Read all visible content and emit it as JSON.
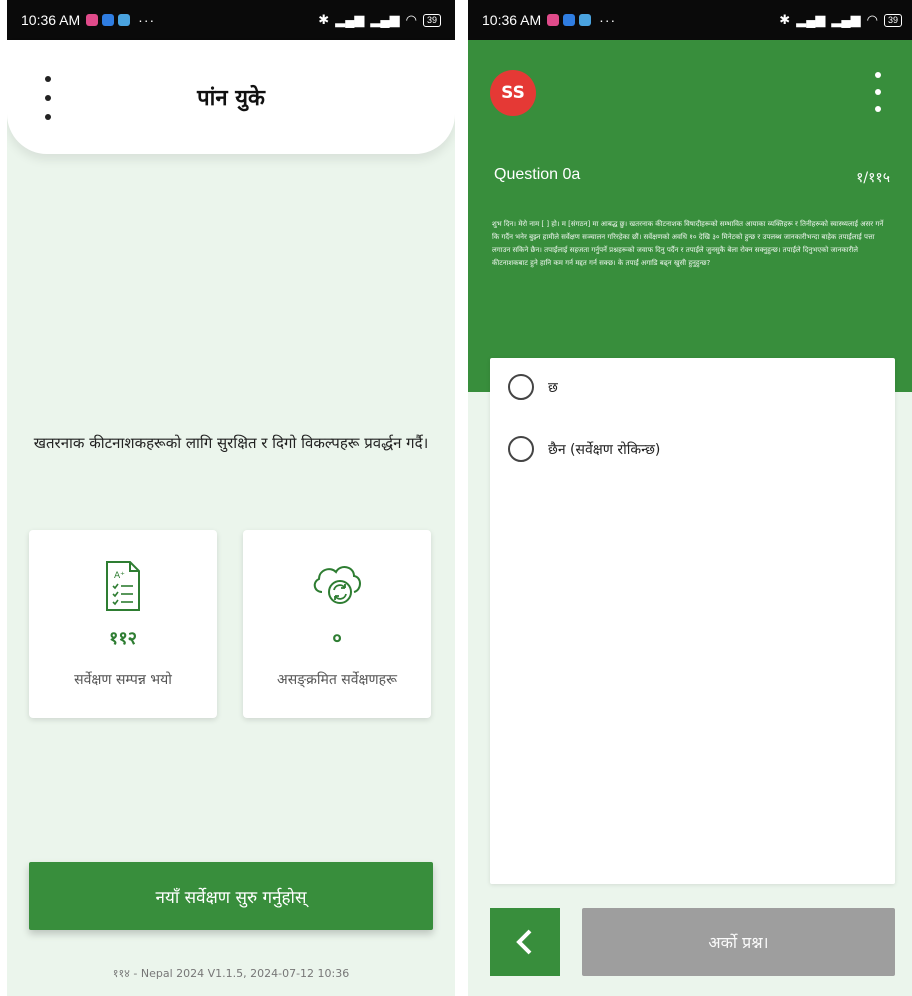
{
  "status_bar": {
    "time": "10:36 AM",
    "overflow": "···",
    "battery": "39"
  },
  "left_screen": {
    "appbar": {
      "title": "पांन युके",
      "menu_icon": "kebab-menu-icon"
    },
    "tagline": "खतरनाक कीटनाशकहरूको लागि सुरक्षित र दिगो विकल्पहरू प्रवर्द्धन गर्दै।",
    "cards": [
      {
        "icon": "checklist-document-icon",
        "value": "११२",
        "label": "सर्वेक्षण सम्पन्न भयो"
      },
      {
        "icon": "cloud-sync-icon",
        "value": "०",
        "label": "असङ्क्रमित सर्वेक्षणहरू"
      }
    ],
    "start_button": "नयाँ सर्वेक्षण सुरु गर्नुहोस्",
    "footer": "११४ - Nepal 2024 V1.1.5, 2024-07-12 10:36"
  },
  "right_screen": {
    "avatar_initials": "SS",
    "question_label": "Question 0a",
    "question_counter": "१/११५",
    "question_text": "शुभ दिन। मेरो नाम [ ] हो। म [संगठन] मा आबद्ध छु। खतरनाक कीटनाशक विषादीहरूको सम्भावित आयाका व्यक्तिहरू र तिनीहरूको स्वास्थ्यलाई असर गर्ने कि गर्दैन भनेर बुझ्न हामीले सर्वेक्षण सञ्चालन गरिरहेका छौं। सर्वेक्षणको अवधि १० देखि ३० मिनेटको हुन्छ र उपलब्ध जानकारीभन्दा बाहेक तपाईंलाई पत्ता लगाउन सकिने छैन। तपाईंलाई सहजता गर्नुपर्ने प्रश्नहरूको जवाफ दिनु पर्दैन र तपाईंले जुनसुकै बेला रोक्न सक्नुहुन्छ। तपाईंले दिनुभएको जानकारीले कीटनाशकबाट हुने हानि कम गर्न मद्दत गर्न सक्छ। के तपाईं अगाडि बढ्न खुसी हुनुहुन्छ?",
    "options": [
      {
        "label": "छ"
      },
      {
        "label": "छैन (सर्वेक्षण रोकिन्छ)"
      }
    ],
    "back_icon": "chevron-left-icon",
    "next_button": "अर्को प्रश्न।"
  },
  "colors": {
    "primary_green": "#388e3c",
    "avatar_red": "#e53935",
    "disabled_gray": "#9e9e9e",
    "background_tint": "#ebf5ec"
  }
}
